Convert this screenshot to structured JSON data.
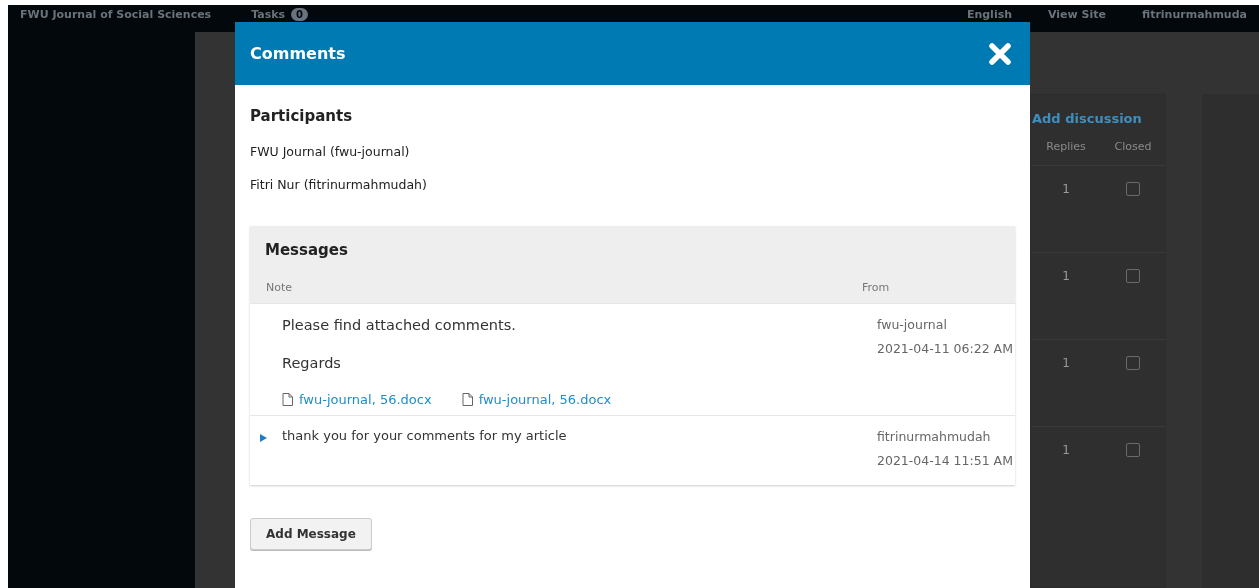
{
  "topbar": {
    "site_title": "FWU Journal of Social Sciences",
    "tasks_label": "Tasks",
    "tasks_count": "0",
    "language": "English",
    "view_site": "View Site",
    "user": "fitrinurmahmuda"
  },
  "discussions": {
    "add_label": "Add discussion",
    "columns": [
      "Replies",
      "Closed"
    ],
    "rows": [
      {
        "replies": "1",
        "closed": false
      },
      {
        "replies": "1",
        "closed": false
      },
      {
        "replies": "1",
        "closed": false
      },
      {
        "replies": "1",
        "closed": false
      }
    ]
  },
  "modal": {
    "title": "Comments",
    "participants_heading": "Participants",
    "participants": [
      "FWU Journal (fwu-journal)",
      "Fitri Nur (fitrinurmahmudah)"
    ],
    "messages": {
      "heading": "Messages",
      "columns": [
        "Note",
        "From"
      ],
      "rows": [
        {
          "expanded": true,
          "paragraphs": [
            "Please find attached comments.",
            "Regards"
          ],
          "files": [
            "fwu-journal, 56.docx",
            "fwu-journal, 56.docx"
          ],
          "from": [
            "fwu-journal",
            "2021-04-11 06:22 AM"
          ]
        },
        {
          "expanded": false,
          "paragraphs": [
            "thank you for your comments for my article"
          ],
          "files": [],
          "from": [
            "fitrinurmahmudah",
            "2021-04-14 11:51 AM"
          ]
        }
      ]
    },
    "add_button": "Add Message"
  }
}
